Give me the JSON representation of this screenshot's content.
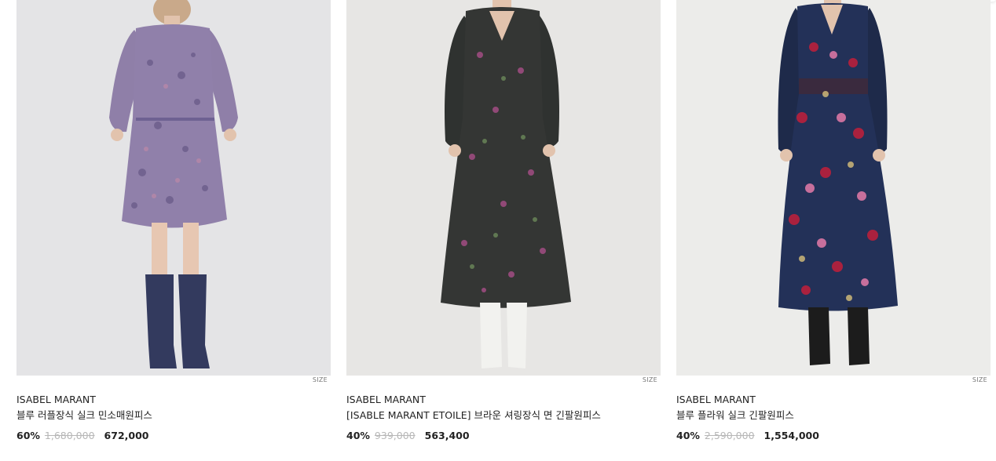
{
  "products": [
    {
      "brand": "ISABEL MARANT",
      "name": "블루 러플장식 실크 민소매원피스",
      "discount": "60%",
      "original_price": "1,680,000",
      "sale_price": "672,000",
      "size_label": "SIZE"
    },
    {
      "brand": "ISABEL MARANT",
      "name": "[ISABLE MARANT ETOILE] 브라운 셔링장식 면 긴팔원피스",
      "discount": "40%",
      "original_price": "939,000",
      "sale_price": "563,400",
      "size_label": "SIZE"
    },
    {
      "brand": "ISABEL MARANT",
      "name": "블루 플라워 실크 긴팔원피스",
      "discount": "40%",
      "original_price": "2,590,000",
      "sale_price": "1,554,000",
      "size_label": "SIZE"
    }
  ],
  "colors": {
    "photo_bg_1": "#e4e4e6",
    "photo_bg_2": "#e7e6e4",
    "photo_bg_3": "#ececea",
    "text": "#222222",
    "strikethrough": "#b7b7b7"
  }
}
